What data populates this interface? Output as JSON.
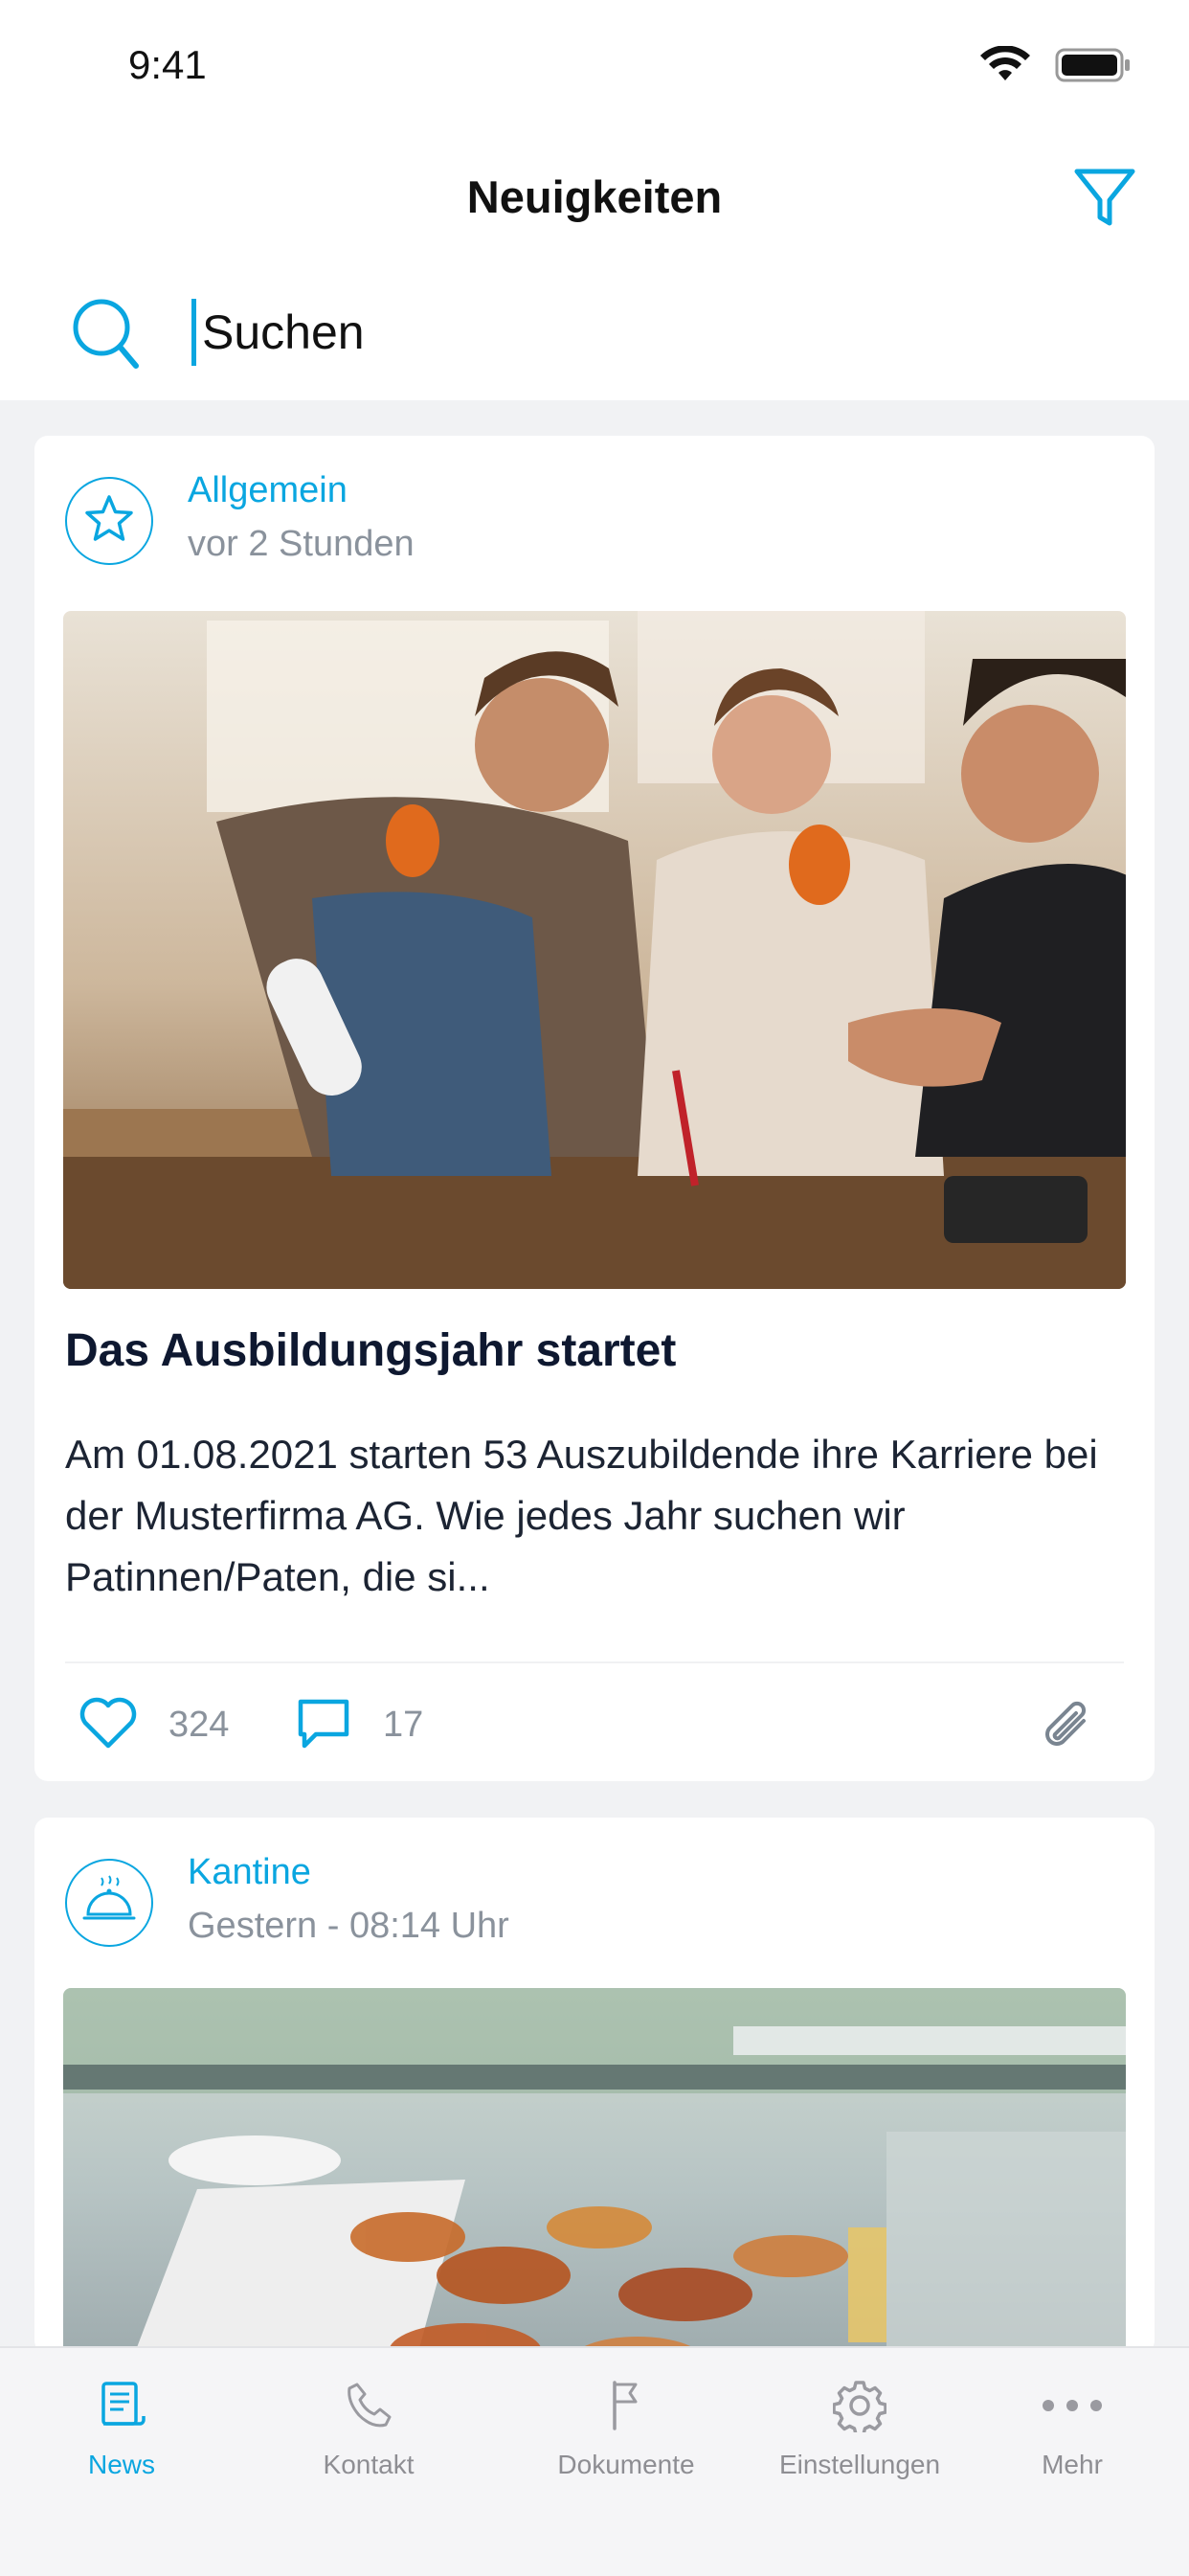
{
  "status_bar": {
    "time": "9:41"
  },
  "header": {
    "title": "Neuigkeiten",
    "filter_icon": "filter-icon"
  },
  "search": {
    "placeholder": "Suchen",
    "value": "",
    "icon": "search-icon"
  },
  "colors": {
    "accent": "#0aa6e0",
    "background": "#f1f2f4",
    "card": "#ffffff",
    "muted": "#8a929c",
    "heading": "#0e1830"
  },
  "feed": {
    "posts": [
      {
        "category": "Allgemein",
        "category_icon": "star-icon",
        "time": "vor 2 Stunden",
        "image": "workshop-apprentices-photo",
        "title": "Das Ausbildungsjahr startet",
        "excerpt": "Am 01.08.2021 starten 53 Auszubildende ihre Karriere bei der Musterfirma AG. Wie jedes Jahr suchen wir Patinnen/Paten, die si...",
        "likes": "324",
        "comments": "17",
        "has_attachment": true
      },
      {
        "category": "Kantine",
        "category_icon": "cloche-icon",
        "time": "Gestern - 08:14 Uhr",
        "image": "canteen-buffet-photo"
      }
    ]
  },
  "tabbar": {
    "tabs": [
      {
        "label": "News",
        "icon": "news-icon",
        "active": true
      },
      {
        "label": "Kontakt",
        "icon": "phone-icon",
        "active": false
      },
      {
        "label": "Dokumente",
        "icon": "flag-icon",
        "active": false
      },
      {
        "label": "Einstellungen",
        "icon": "gear-icon",
        "active": false
      },
      {
        "label": "Mehr",
        "icon": "more-icon",
        "active": false
      }
    ]
  }
}
